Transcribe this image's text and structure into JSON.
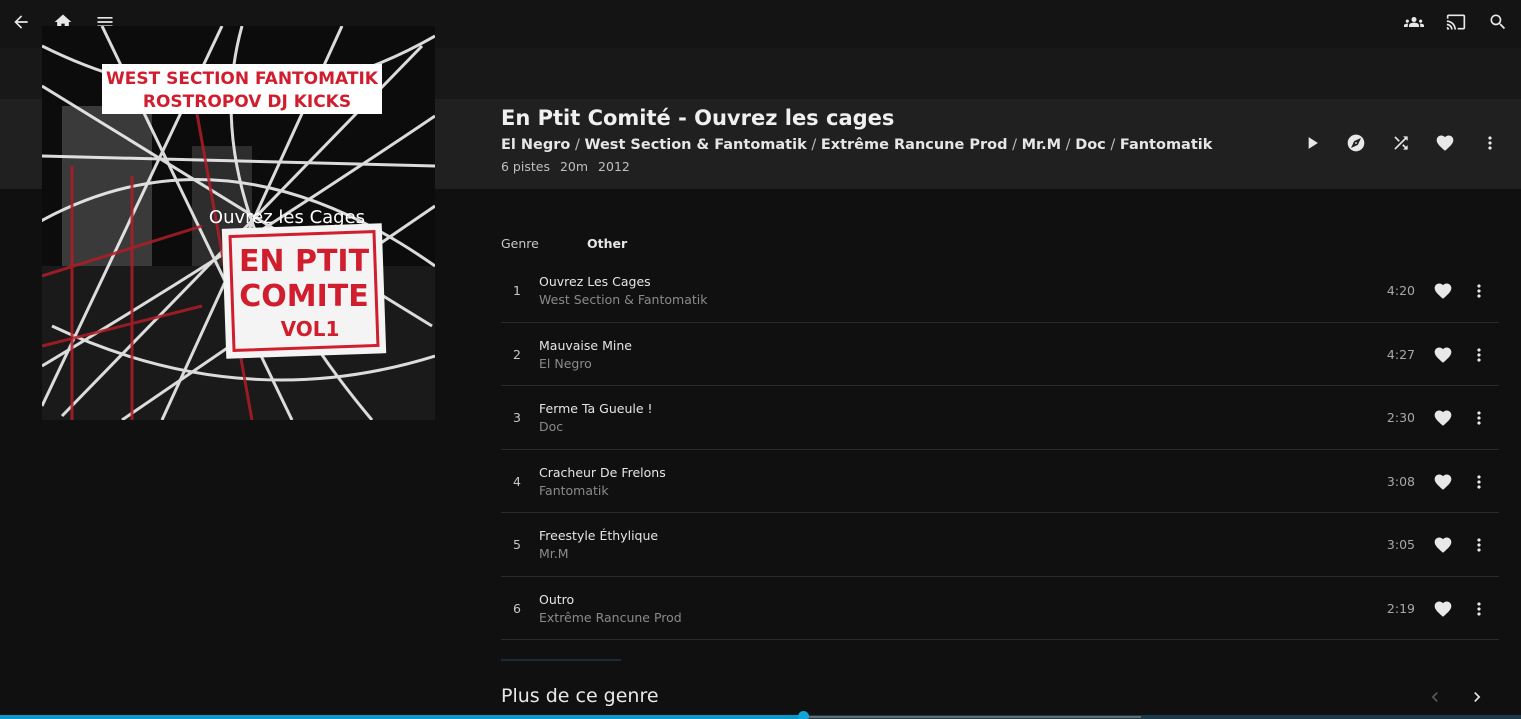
{
  "nav": {
    "back_icon": "arrow-back-icon",
    "home_icon": "home-icon",
    "menu_icon": "hamburger-menu-icon",
    "syncplay_icon": "group-icon",
    "cast_icon": "cast-icon",
    "search_icon": "search-icon"
  },
  "album": {
    "title": "En Ptit Comité - Ouvrez les cages",
    "artists": [
      "El Negro",
      "West Section & Fantomatik",
      "Extrême Rancune Prod",
      "Mr.M",
      "Doc",
      "Fantomatik"
    ],
    "separator": " / ",
    "track_count": "6 pistes",
    "duration": "20m",
    "year": "2012",
    "cover": {
      "lines": [
        "WEST SECTION FANTOMATIK",
        "ROSTROPOV DJ KICKS",
        "Ouvrez les Cages",
        "EN PTIT",
        "COMITE",
        "VOL1"
      ],
      "accent": "#d01e2e"
    }
  },
  "actions": {
    "play_icon": "play-icon",
    "instant_mix_icon": "explore-icon",
    "shuffle_icon": "shuffle-icon",
    "favorite_icon": "heart-icon",
    "more_icon": "more-vertical-icon"
  },
  "details": {
    "genre_label": "Genre",
    "genre_value": "Other"
  },
  "tracks": [
    {
      "num": "1",
      "title": "Ouvrez Les Cages",
      "artist": "West Section & Fantomatik",
      "duration": "4:20"
    },
    {
      "num": "2",
      "title": "Mauvaise Mine",
      "artist": "El Negro",
      "duration": "4:27"
    },
    {
      "num": "3",
      "title": "Ferme Ta Gueule !",
      "artist": "Doc",
      "duration": "2:30"
    },
    {
      "num": "4",
      "title": "Cracheur De Frelons",
      "artist": "Fantomatik",
      "duration": "3:08"
    },
    {
      "num": "5",
      "title": "Freestyle Éthylique",
      "artist": "Mr.M",
      "duration": "3:05"
    },
    {
      "num": "6",
      "title": "Outro",
      "artist": "Extrême Rancune Prod",
      "duration": "2:19"
    }
  ],
  "more_like_this": {
    "title": "Plus de ce genre",
    "prev_icon": "chevron-left-icon",
    "next_icon": "chevron-right-icon"
  },
  "playback": {
    "progress_fraction": 0.528,
    "buffered_fraction": 0.75,
    "accent": "#0b97c9"
  }
}
